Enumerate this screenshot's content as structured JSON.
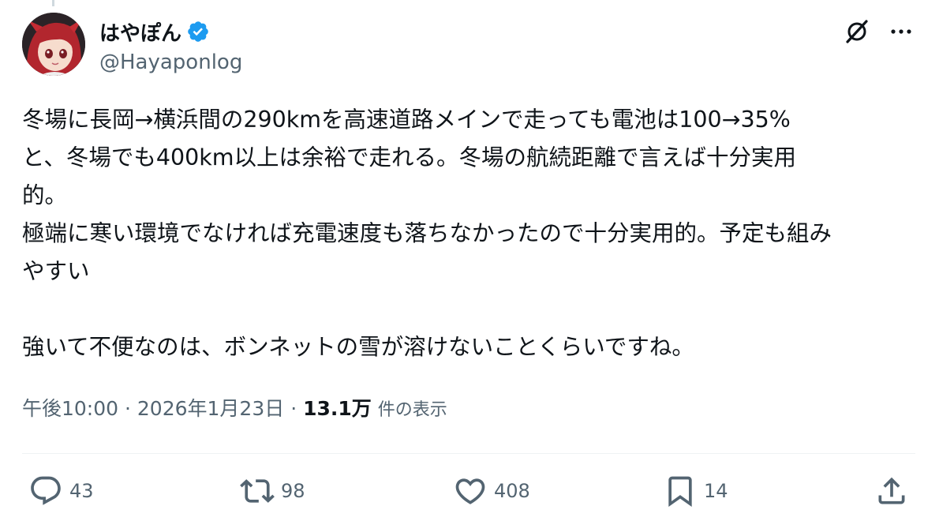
{
  "author": {
    "display_name": "はやぽん",
    "handle": "@Hayaponlog",
    "verified": true
  },
  "tweet": {
    "text": "冬場に長岡→横浜間の290kmを高速道路メインで走っても電池は100→35%\nと、冬場でも400km以上は余裕で走れる。冬場の航続距離で言えば十分実用\n的。\n極端に寒い環境でなければ充電速度も落ちなかったので十分実用的。予定も組み\nやすい\n\n強いて不便なのは、ボンネットの雪が溶けないことくらいですね。",
    "time": "午後10:00",
    "separator1": "·",
    "date": "2026年1月23日",
    "separator2": "·",
    "views_count": "13.1万",
    "views_label": "件の表示"
  },
  "actions": {
    "reply_count": "43",
    "retweet_count": "98",
    "like_count": "408",
    "bookmark_count": "14"
  },
  "icons": {
    "verified": "verified-badge-icon",
    "grok": "grok-icon",
    "more": "more-icon",
    "reply": "reply-icon",
    "retweet": "retweet-icon",
    "like": "heart-icon",
    "bookmark": "bookmark-icon",
    "share": "share-icon"
  },
  "colors": {
    "text": "#0f1419",
    "secondary": "#536471",
    "verified": "#1d9bf0",
    "divider": "#eff3f4"
  }
}
